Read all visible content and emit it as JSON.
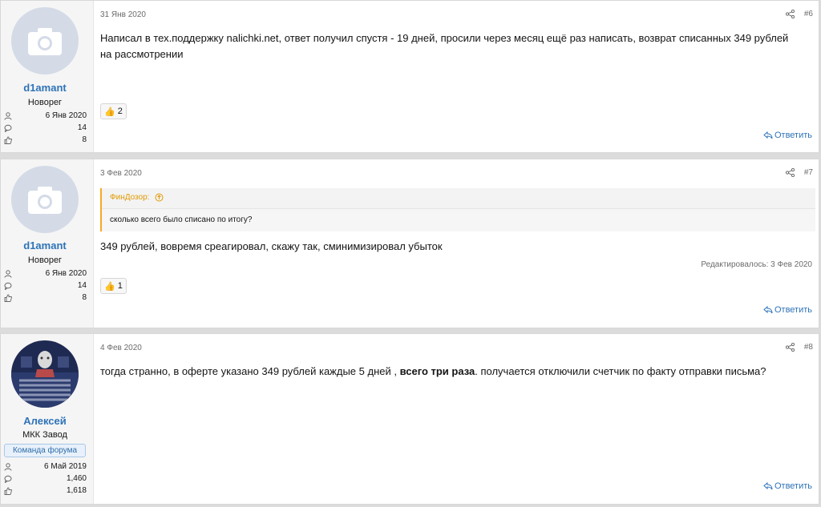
{
  "posts": [
    {
      "username": "d1amant",
      "user_title": "Новорег",
      "stats": [
        {
          "icon": "user-icon",
          "value": "6 Янв 2020"
        },
        {
          "icon": "comment-icon",
          "value": "14"
        },
        {
          "icon": "thumbs-up-icon",
          "value": "8"
        }
      ],
      "date": "31 Янв 2020",
      "number": "#6",
      "message": "Написал в тех.поддержку nalichki.net, ответ получил спустя - 19 дней, просили через месяц ещё раз написать, возврат списанных 349 рублей на рассмотрении",
      "reaction_count": "2",
      "reply_label": "Ответить"
    },
    {
      "username": "d1amant",
      "user_title": "Новорег",
      "stats": [
        {
          "icon": "user-icon",
          "value": "6 Янв 2020"
        },
        {
          "icon": "comment-icon",
          "value": "14"
        },
        {
          "icon": "thumbs-up-icon",
          "value": "8"
        }
      ],
      "date": "3 Фев 2020",
      "number": "#7",
      "quote_author": "ФинДозор:",
      "quote_text": "сколько всего было списано по итогу?",
      "message": "349 рублей, вовремя среагировал, скажу так, сминимизировал убыток",
      "edited": "Редактировалось: 3 Фев 2020",
      "reaction_count": "1",
      "reply_label": "Ответить"
    },
    {
      "username": "Алексей",
      "user_title": "МКК Завод",
      "banner": "Команда форума",
      "stats": [
        {
          "icon": "user-icon",
          "value": "6 Май 2019"
        },
        {
          "icon": "comment-icon",
          "value": "1,460"
        },
        {
          "icon": "thumbs-up-icon",
          "value": "1,618"
        }
      ],
      "date": "4 Фев 2020",
      "number": "#8",
      "message_part1": "тогда странно, в оферте указано 349 рублей каждые 5 дней , ",
      "message_bold": "всего три раза",
      "message_part2": ". получается отключили счетчик по факту отправки письма?",
      "reply_label": "Ответить"
    }
  ],
  "colors": {
    "link": "#2e73b8",
    "quote_accent": "#f9a825",
    "muted": "#6b6b6b"
  }
}
